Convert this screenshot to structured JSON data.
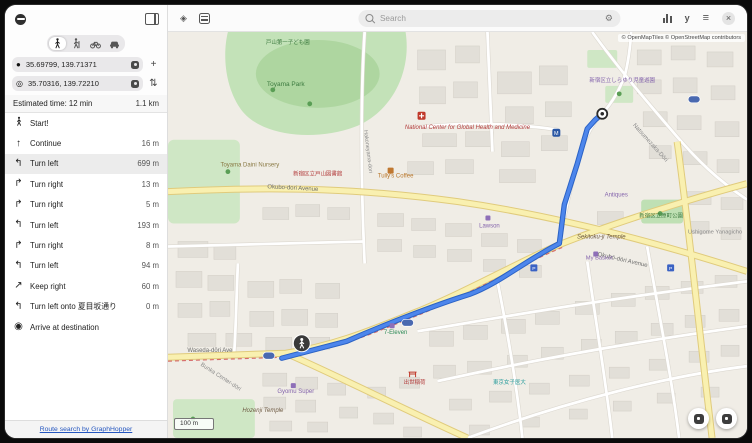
{
  "topbar": {
    "search_placeholder": "Search",
    "icons": {
      "left1": "directions",
      "left2": "transit",
      "settings": "gear",
      "stats": "bars",
      "filter": "y",
      "menu": "hamburger",
      "close": "x"
    }
  },
  "sidebar": {
    "profiles": [
      {
        "name": "foot",
        "selected": true
      },
      {
        "name": "hike",
        "selected": false
      },
      {
        "name": "bike",
        "selected": false
      },
      {
        "name": "car",
        "selected": false
      }
    ],
    "inputs": [
      {
        "role": "start",
        "value": "35.69799, 139.71371"
      },
      {
        "role": "destination",
        "value": "35.70316, 139.72210"
      }
    ],
    "add_label": "+",
    "swap_glyph": "⇅",
    "summary": {
      "time_label": "Estimated time: 12 min",
      "distance": "1.1 km"
    },
    "instructions": [
      {
        "icon": "walk",
        "glyph": "",
        "text": "Start!",
        "distance": ""
      },
      {
        "icon": "continue",
        "glyph": "↑",
        "text": "Continue",
        "distance": "16 m"
      },
      {
        "icon": "turn-left",
        "glyph": "↰",
        "text": "Turn left",
        "distance": "699 m"
      },
      {
        "icon": "turn-right",
        "glyph": "↱",
        "text": "Turn right",
        "distance": "13 m"
      },
      {
        "icon": "turn-right",
        "glyph": "↱",
        "text": "Turn right",
        "distance": "5 m"
      },
      {
        "icon": "turn-left",
        "glyph": "↰",
        "text": "Turn left",
        "distance": "193 m"
      },
      {
        "icon": "turn-right",
        "glyph": "↱",
        "text": "Turn right",
        "distance": "8 m"
      },
      {
        "icon": "turn-left",
        "glyph": "↰",
        "text": "Turn left",
        "distance": "94 m"
      },
      {
        "icon": "keep-right",
        "glyph": "↗",
        "text": "Keep right",
        "distance": "60 m"
      },
      {
        "icon": "turn-left",
        "glyph": "↰",
        "text": "Turn left onto 夏目坂通り",
        "distance": "0 m"
      },
      {
        "icon": "arrive",
        "glyph": "◉",
        "text": "Arrive at destination",
        "distance": ""
      }
    ],
    "footer_link": "Route search by GraphHopper"
  },
  "map": {
    "attribution": "© OpenMapTiles © OpenStreetMap contributors",
    "scale_label": "100 m",
    "route_color": "#4d86ec",
    "labels": [
      {
        "text": "Toyama Park",
        "color": "#3c7a3f"
      },
      {
        "text": "戸山第一子ども園",
        "color": "#3c7a3f"
      },
      {
        "text": "National Center for Global Health and Medicine",
        "color": "#b23b3b"
      },
      {
        "text": "新宿区立戸山図書館",
        "color": "#b23b3b"
      },
      {
        "text": "Toyama Daini Nursery",
        "color": "#8a7a45"
      },
      {
        "text": "Okubo-dori Avenue",
        "color": "#6d6d6d"
      },
      {
        "text": "Okubō-dōri Avenue",
        "color": "#6d6d6d"
      },
      {
        "text": "Tully's Coffee",
        "color": "#b8762a"
      },
      {
        "text": "Hakoneyama-dori",
        "color": "#8a8a8a"
      },
      {
        "text": "新宿区立しらゆり児童遊園",
        "color": "#8464ac"
      },
      {
        "text": "Antiques",
        "color": "#8464ac"
      },
      {
        "text": "新宿区立原町公園",
        "color": "#3c7a3f"
      },
      {
        "text": "Sekitoku-ji Temple",
        "color": "#6e5a43"
      },
      {
        "text": "Ushigome Yanagicho",
        "color": "#8a8a8a"
      },
      {
        "text": "Natsumezaka-Dōri",
        "color": "#8a8a8a"
      },
      {
        "text": "Lawson",
        "color": "#8464ac"
      },
      {
        "text": "7-Eleven",
        "color": "#2e8b57"
      },
      {
        "text": "Gyomu Super",
        "color": "#8464ac"
      },
      {
        "text": "Hozenji Temple",
        "color": "#6e5a43"
      },
      {
        "text": "Bunka Center-dōri",
        "color": "#8a8a8a"
      },
      {
        "text": "My Basket",
        "color": "#8464ac"
      },
      {
        "text": "出世稲荷",
        "color": "#b23b3b"
      },
      {
        "text": "東京女子医大",
        "color": "#2a9d9d"
      },
      {
        "text": "Waseda-dōri Ave",
        "color": "#6d6d6d"
      }
    ]
  }
}
